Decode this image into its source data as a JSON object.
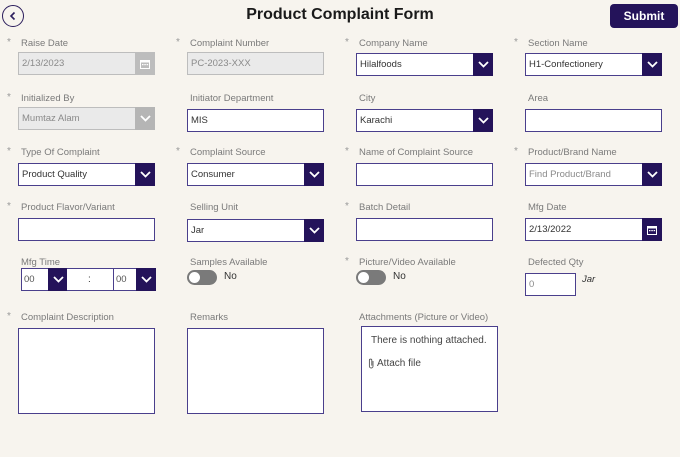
{
  "header": {
    "title": "Product Complaint Form",
    "submit_label": "Submit"
  },
  "colors": {
    "accent": "#24135a",
    "background": "#f7f4ee",
    "border": "#4a3f8c"
  },
  "fields": {
    "raise_date": {
      "label": "Raise Date",
      "value": "2/13/2023"
    },
    "complaint_number": {
      "label": "Complaint Number",
      "value": "PC-2023-XXX"
    },
    "company_name": {
      "label": "Company Name",
      "value": "Hilalfoods"
    },
    "section_name": {
      "label": "Section Name",
      "value": "H1-Confectionery"
    },
    "initialized_by": {
      "label": "Initialized By",
      "value": "Mumtaz Alam"
    },
    "initiator_department": {
      "label": "Initiator Department",
      "value": "MIS"
    },
    "city": {
      "label": "City",
      "value": "Karachi"
    },
    "area": {
      "label": "Area",
      "value": ""
    },
    "type_of_complaint": {
      "label": "Type Of Complaint",
      "value": "Product Quality"
    },
    "complaint_source": {
      "label": "Complaint Source",
      "value": "Consumer"
    },
    "name_of_complaint_source": {
      "label": "Name of Complaint Source",
      "value": ""
    },
    "product_brand_name": {
      "label": "Product/Brand Name",
      "placeholder": "Find Product/Brand"
    },
    "product_flavor_variant": {
      "label": "Product Flavor/Variant",
      "value": ""
    },
    "selling_unit": {
      "label": "Selling Unit",
      "value": "Jar"
    },
    "batch_detail": {
      "label": "Batch Detail",
      "value": ""
    },
    "mfg_date": {
      "label": "Mfg Date",
      "value": "2/13/2022"
    },
    "mfg_time": {
      "label": "Mfg Time",
      "hour": "00",
      "separator": ":",
      "minute": "00"
    },
    "samples_available": {
      "label": "Samples Available",
      "state": "No"
    },
    "picture_video_available": {
      "label": "Picture/Video Available",
      "state": "No"
    },
    "defected_qty": {
      "label": "Defected Qty",
      "value": "0",
      "unit": "Jar"
    },
    "complaint_description": {
      "label": "Complaint Description"
    },
    "remarks": {
      "label": "Remarks"
    },
    "attachments": {
      "label": "Attachments (Picture or Video)",
      "empty_text": "There is nothing attached.",
      "attach_label": "Attach file"
    }
  },
  "required_marker": "*"
}
